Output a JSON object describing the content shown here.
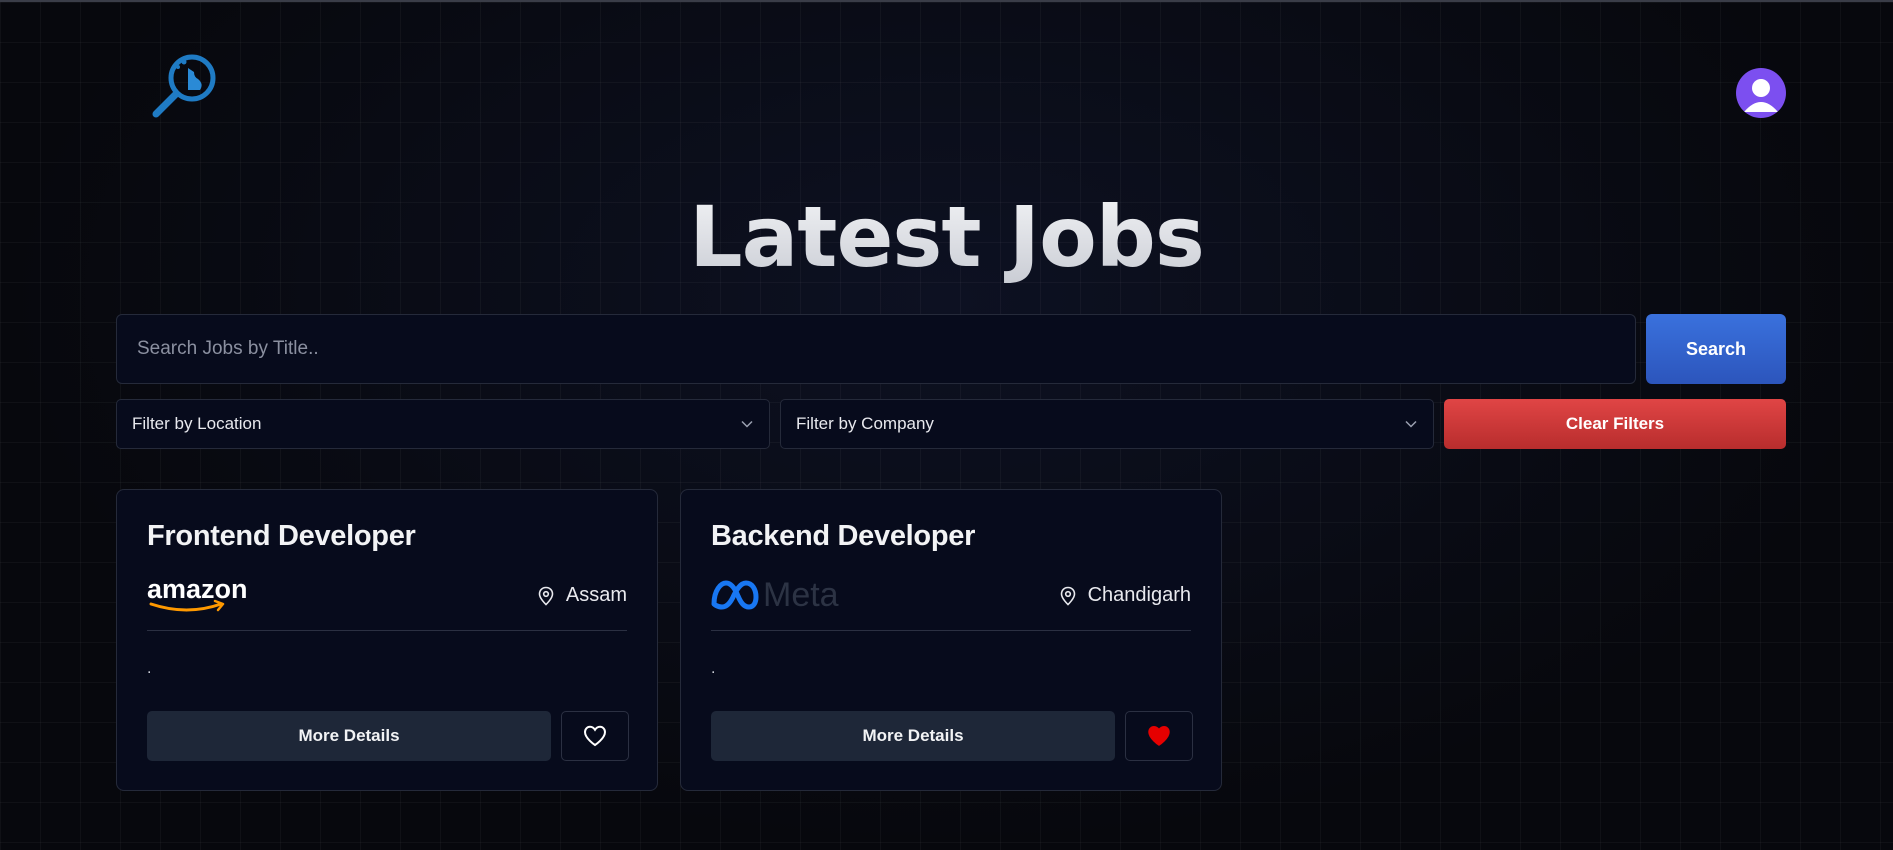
{
  "header": {
    "logo_icon": "search-magnifier-logo-icon",
    "avatar_icon": "user-avatar-icon"
  },
  "page": {
    "title": "Latest Jobs"
  },
  "search": {
    "placeholder": "Search Jobs by Title..",
    "value": "",
    "button_label": "Search"
  },
  "filters": {
    "location_label": "Filter by Location",
    "company_label": "Filter by Company",
    "clear_label": "Clear Filters"
  },
  "jobs": [
    {
      "title": "Frontend Developer",
      "company": "amazon",
      "location": "Assam",
      "description": ".",
      "details_label": "More Details",
      "favorited": false
    },
    {
      "title": "Backend Developer",
      "company": "Meta",
      "location": "Chandigarh",
      "description": ".",
      "details_label": "More Details",
      "favorited": true
    }
  ],
  "colors": {
    "search_button": "#3a71dd",
    "clear_button": "#d63c3c",
    "avatar": "#7c4ff0",
    "favorite_active": "#e60000"
  }
}
